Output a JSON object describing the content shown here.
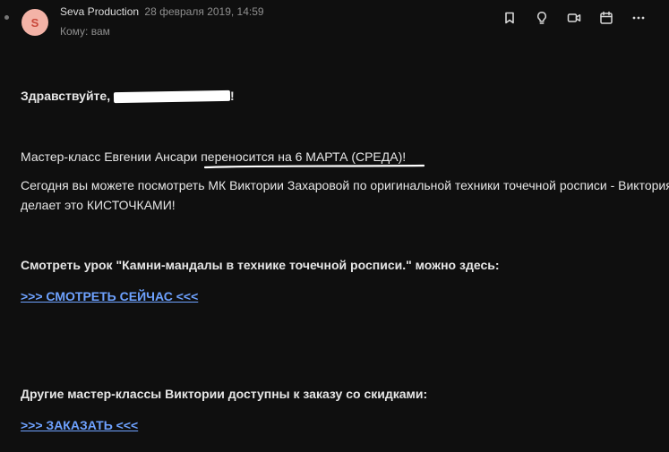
{
  "header": {
    "avatar_letter": "S",
    "sender_name": "Seva Production",
    "date": "28 февраля 2019, 14:59",
    "recipient": "Кому: вам"
  },
  "toolbar": {
    "icons": [
      "bookmark-icon",
      "lightbulb-icon",
      "video-icon",
      "calendar-icon",
      "more-icon"
    ]
  },
  "message": {
    "greeting": "Здравствуйте,",
    "greeting_end": "!",
    "para1_start": "Мастер-класс Евгении Ансари ",
    "para1_highlight": "переносится на 6 МАРТА (СРЕДА)!",
    "para2": "Сегодня вы можете посмотреть МК Виктории Захаровой по оригинальной техники точечной росписи - Виктория делает это КИСТОЧКАМИ!",
    "watch_heading": "Смотреть урок \"Камни-мандалы в технике точечной росписи.\" можно здесь:",
    "watch_link": ">>> СМОТРЕТЬ СЕЙЧАС <<<",
    "order_heading": "Другие мастер-классы Виктории доступны к заказу со скидками:",
    "order_link": ">>> ЗАКАЗАТЬ <<<"
  },
  "colors": {
    "background": "#0f0f0f",
    "link": "#6ea2ff",
    "avatar_bg": "#f3b3a7",
    "avatar_fg": "#c8473a"
  }
}
